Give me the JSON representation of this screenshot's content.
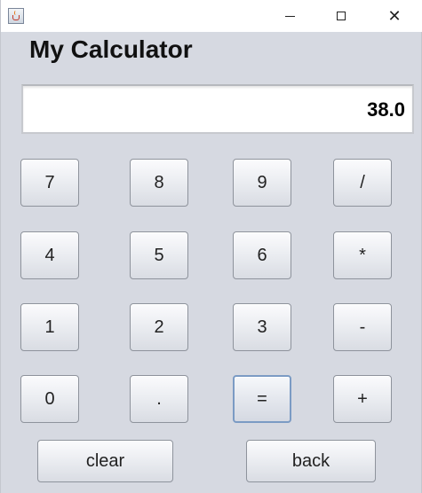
{
  "window": {
    "icon": "java-cup-icon",
    "controls": {
      "minimize": "minimize-icon",
      "maximize": "maximize-icon",
      "close_glyph": "✕"
    }
  },
  "app": {
    "title": "My Calculator"
  },
  "display": {
    "value": "38.0"
  },
  "keypad": {
    "rows": [
      [
        "7",
        "8",
        "9",
        "/"
      ],
      [
        "4",
        "5",
        "6",
        "*"
      ],
      [
        "1",
        "2",
        "3",
        "-"
      ],
      [
        "0",
        ".",
        "=",
        "+"
      ]
    ],
    "focused_key": "="
  },
  "actions": {
    "clear_label": "clear",
    "back_label": "back"
  }
}
